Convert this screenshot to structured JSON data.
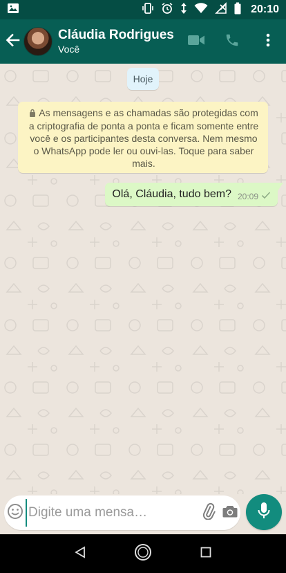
{
  "status_bar": {
    "time": "20:10",
    "icons": [
      "image-icon",
      "vibrate-icon",
      "alarm-icon",
      "data-arrows-icon",
      "wifi-icon",
      "no-signal-icon",
      "battery-icon"
    ]
  },
  "header": {
    "contact_name": "Cláudia Rodrigues",
    "subtitle": "Você",
    "actions": [
      "video-call-icon",
      "phone-icon",
      "more-vert-icon"
    ]
  },
  "chat": {
    "date_label": "Hoje",
    "security_note": "As mensagens e as chamadas são protegidas com a criptografia de ponta a ponta e ficam somente entre você e os participantes desta conversa. Nem mesmo o WhatsApp pode ler ou ouvi-las. Toque para saber mais.",
    "messages": [
      {
        "text": "Olá, Cláudia, tudo bem?",
        "time": "20:09",
        "status": "sent"
      }
    ]
  },
  "composer": {
    "placeholder": "Digite uma mensa…",
    "value": ""
  },
  "colors": {
    "header": "#075e54",
    "status_bar": "#054d44",
    "accent": "#128c7e",
    "outgoing_bubble": "#dcf8c6",
    "notice_bubble": "#fcf4c4",
    "date_chip": "#e1f3fb",
    "chat_background": "#ece5dd"
  }
}
